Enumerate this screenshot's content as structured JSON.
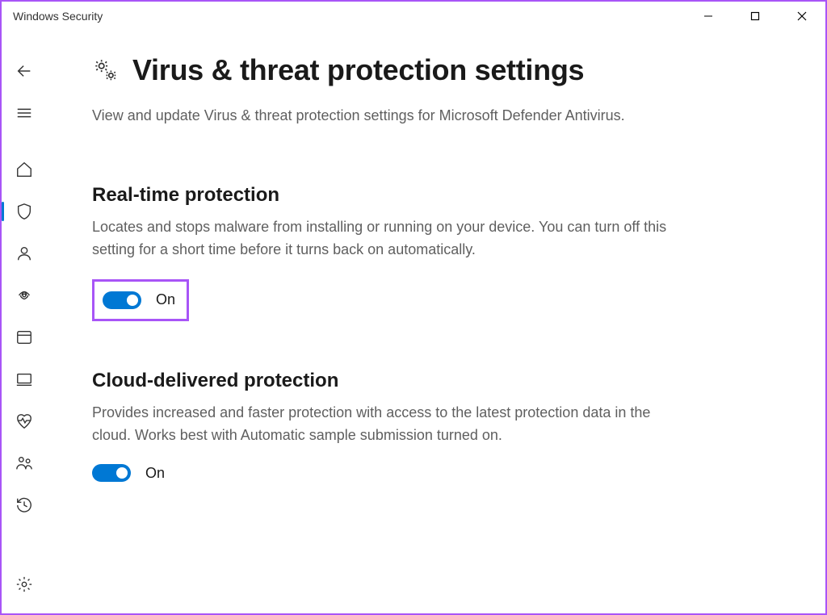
{
  "window": {
    "title": "Windows Security"
  },
  "page": {
    "title": "Virus & threat protection settings",
    "description": "View and update Virus & threat protection settings for Microsoft Defender Antivirus."
  },
  "sections": {
    "realtime": {
      "title": "Real-time protection",
      "description": "Locates and stops malware from installing or running on your device. You can turn off this setting for a short time before it turns back on automatically.",
      "toggle_state": "On"
    },
    "cloud": {
      "title": "Cloud-delivered protection",
      "description": "Provides increased and faster protection with access to the latest protection data in the cloud. Works best with Automatic sample submission turned on.",
      "toggle_state": "On"
    }
  },
  "colors": {
    "accent": "#0078d4",
    "highlight": "#a855f7"
  }
}
